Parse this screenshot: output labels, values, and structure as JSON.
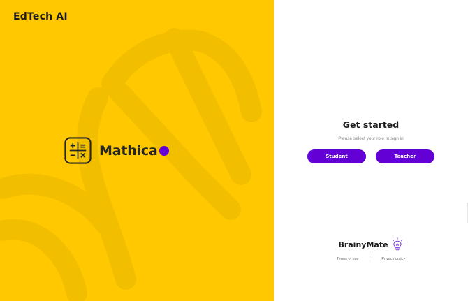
{
  "left": {
    "header_brand": "EdTech AI",
    "app_name": "Mathica",
    "icon": "calculator-icon"
  },
  "right": {
    "title": "Get started",
    "subtitle": "Please select your role to sign in",
    "buttons": {
      "student": "Student",
      "teacher": "Teacher"
    },
    "footer": {
      "brand": "BrainyMate",
      "brand_icon": "lightbulb-icon",
      "terms": "Terms of use",
      "privacy": "Privacy policy"
    }
  },
  "colors": {
    "brand_yellow": "#ffc800",
    "accent_purple": "#6200d6",
    "text_dark": "#1c1c1c"
  }
}
